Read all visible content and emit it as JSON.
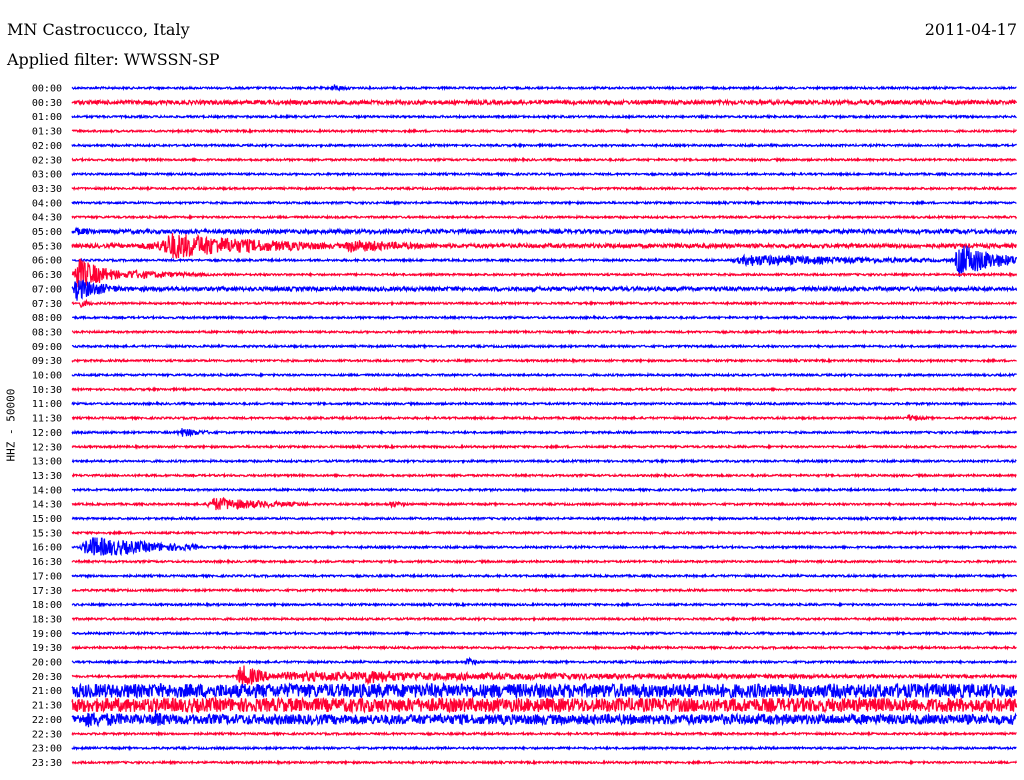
{
  "header": {
    "station": "MN Castrocucco, Italy",
    "date": "2011-04-17",
    "filter": "Applied filter: WWSSN-SP"
  },
  "chart_data": {
    "type": "line",
    "subtype": "helicorder",
    "ylabel": "HHZ - 50000",
    "row_labels": [
      "00:00",
      "00:30",
      "01:00",
      "01:30",
      "02:00",
      "02:30",
      "03:00",
      "03:30",
      "04:00",
      "04:30",
      "05:00",
      "05:30",
      "06:00",
      "06:30",
      "07:00",
      "07:30",
      "08:00",
      "08:30",
      "09:00",
      "09:30",
      "10:00",
      "10:30",
      "11:00",
      "11:30",
      "12:00",
      "12:30",
      "13:00",
      "13:30",
      "14:00",
      "14:30",
      "15:00",
      "15:30",
      "16:00",
      "16:30",
      "17:00",
      "17:30",
      "18:00",
      "18:30",
      "19:00",
      "19:30",
      "20:00",
      "20:30",
      "21:00",
      "21:30",
      "22:00",
      "22:30",
      "23:00",
      "23:30"
    ],
    "colors": [
      "#0000ff",
      "#ff0033"
    ],
    "x_minutes_per_row": 30,
    "baseline_noise": [
      1,
      2,
      1,
      1,
      1,
      1,
      1,
      1,
      1,
      1,
      2,
      2,
      1,
      1,
      2,
      1,
      1,
      1,
      1,
      1,
      1,
      1,
      1,
      1,
      1,
      1,
      1,
      1,
      1,
      1,
      1,
      1,
      1,
      1,
      1,
      1,
      1,
      1,
      1,
      1,
      1,
      1,
      7,
      7,
      5,
      1,
      1,
      1
    ],
    "events": [
      {
        "row": 0,
        "start": 8.2,
        "end": 9.0,
        "amp": 4
      },
      {
        "row": 10,
        "start": 0.0,
        "end": 1.5,
        "amp": 4
      },
      {
        "row": 11,
        "start": 1.5,
        "end": 14.0,
        "amp": 5
      },
      {
        "row": 11,
        "start": 2.6,
        "end": 8.0,
        "amp": 14
      },
      {
        "row": 11,
        "start": 8.5,
        "end": 12.0,
        "amp": 7
      },
      {
        "row": 12,
        "start": 20.8,
        "end": 28.0,
        "amp": 6
      },
      {
        "row": 12,
        "start": 28.0,
        "end": 30.0,
        "amp": 18
      },
      {
        "row": 13,
        "start": 0.0,
        "end": 1.5,
        "amp": 18
      },
      {
        "row": 13,
        "start": 1.5,
        "end": 4.5,
        "amp": 5
      },
      {
        "row": 14,
        "start": 0.0,
        "end": 1.5,
        "amp": 12
      },
      {
        "row": 15,
        "start": 0.2,
        "end": 0.9,
        "amp": 4
      },
      {
        "row": 23,
        "start": 26.5,
        "end": 27.3,
        "amp": 4
      },
      {
        "row": 24,
        "start": 3.3,
        "end": 4.6,
        "amp": 5
      },
      {
        "row": 29,
        "start": 4.2,
        "end": 7.5,
        "amp": 7
      },
      {
        "row": 29,
        "start": 10.0,
        "end": 10.8,
        "amp": 4
      },
      {
        "row": 32,
        "start": 0.2,
        "end": 4.0,
        "amp": 11
      },
      {
        "row": 39,
        "start": 17.5,
        "end": 18.5,
        "amp": 3
      },
      {
        "row": 40,
        "start": 12.5,
        "end": 13.0,
        "amp": 5
      },
      {
        "row": 41,
        "start": 4.8,
        "end": 30.0,
        "amp": 5
      },
      {
        "row": 41,
        "start": 5.2,
        "end": 6.5,
        "amp": 13
      },
      {
        "row": 41,
        "start": 9.0,
        "end": 12.0,
        "amp": 8
      },
      {
        "row": 44,
        "start": 0.0,
        "end": 5.0,
        "amp": 8
      },
      {
        "row": 44,
        "start": 2.5,
        "end": 3.5,
        "amp": 10
      }
    ]
  }
}
